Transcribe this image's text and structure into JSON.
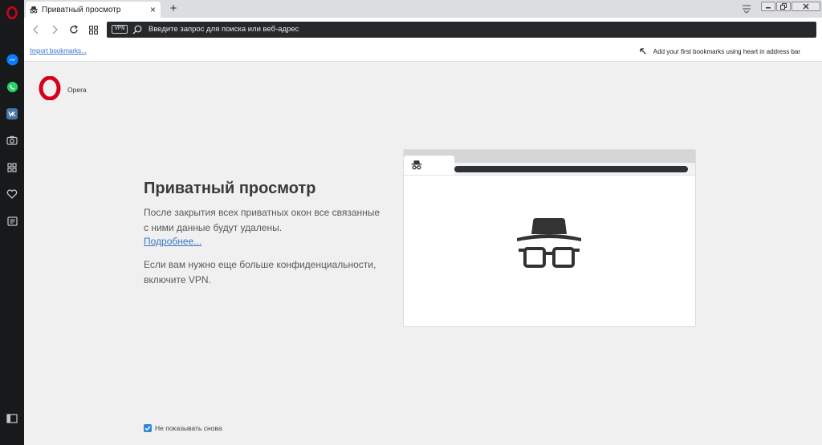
{
  "tab": {
    "title": "Приватный просмотр",
    "new_tab": "+",
    "close": "×"
  },
  "address_bar": {
    "vpn_label": "VPN",
    "placeholder": "Введите запрос для поиска или веб-адрес"
  },
  "bookmarks_bar": {
    "import_link": "Import bookmarks...",
    "hint": "Add your first bookmarks using heart in address bar"
  },
  "brand": {
    "name": "Opera",
    "accent": "#d6001c"
  },
  "main": {
    "title": "Приватный просмотр",
    "description": "После закрытия всех приватных окон все связанные с ними данные будут удалены.",
    "more_link": "Подробнее...",
    "vpn_note": "Если вам нужно еще больше конфиденциальности, включите VPN."
  },
  "footer": {
    "dont_show_label": "Не показывать снова",
    "dont_show_checked": true
  },
  "sidebar": {
    "items": [
      {
        "icon": "messenger-icon",
        "color": "#0084ff"
      },
      {
        "icon": "whatsapp-icon",
        "color": "#25d366"
      },
      {
        "icon": "vk-icon",
        "color": "#4a76a8"
      },
      {
        "icon": "camera-icon"
      },
      {
        "icon": "speed-dial-icon"
      },
      {
        "icon": "heart-icon"
      },
      {
        "icon": "news-icon"
      },
      {
        "icon": "sidebar-toggle-icon"
      }
    ]
  },
  "colors": {
    "link": "#3a74c6",
    "checkbox": "#2f86d8",
    "sidebar_bg": "#17191b",
    "address_bg": "#26292c"
  }
}
